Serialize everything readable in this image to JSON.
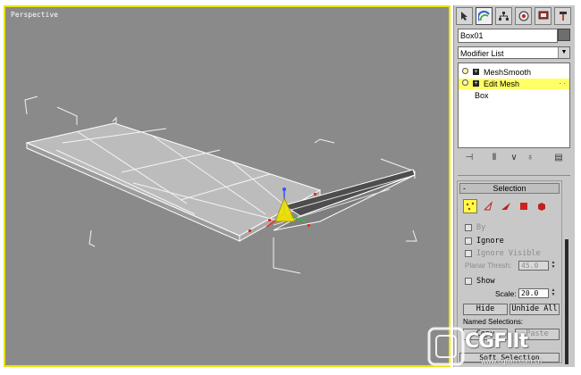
{
  "viewport": {
    "label": "Perspective",
    "border_color": "#e8e400",
    "background": "#8a8a8a"
  },
  "command_panel": {
    "tabs": [
      {
        "name": "create",
        "icon": "cursor-icon"
      },
      {
        "name": "modify",
        "icon": "rainbow-icon"
      },
      {
        "name": "hierarchy",
        "icon": "hierarchy-icon"
      },
      {
        "name": "motion",
        "icon": "motion-icon"
      },
      {
        "name": "display",
        "icon": "display-icon"
      },
      {
        "name": "utilities",
        "icon": "hammer-icon"
      }
    ],
    "object_name": "Box01",
    "object_color": "#6e6e6e",
    "modifier_list": "Modifier List",
    "stack": [
      {
        "label": "MeshSmooth",
        "selected": false
      },
      {
        "label": "Edit Mesh",
        "selected": true
      },
      {
        "label": "Box",
        "selected": false
      }
    ],
    "stack_toolbar": [
      "pin-icon",
      "show-end-icon",
      "make-unique-icon",
      "remove-modifier-icon",
      "configure-icon"
    ]
  },
  "selection": {
    "title": "Selection",
    "collapse_symbol": "-",
    "subobject_levels": [
      "vertex",
      "edge",
      "face",
      "polygon",
      "element"
    ],
    "active_level": "vertex",
    "by_label": "By",
    "ignore_backfacing_label": "Ignore",
    "ignore_visible_label": "Ignore Visible",
    "planar_thresh_label": "Planar Thresh:",
    "planar_thresh_value": "45.0",
    "show_label": "Show",
    "scale_label": "Scale:",
    "scale_value": "20.0",
    "hide_label": "Hide",
    "unhide_all_label": "Unhide All",
    "named_selections_label": "Named Selections:",
    "copy_label": "Copy",
    "paste_label": "Paste",
    "soft_selection_label": "Soft Selection"
  },
  "watermark": {
    "brand": "CGFIIt",
    "url": "www.cgfilm.com.cn"
  }
}
